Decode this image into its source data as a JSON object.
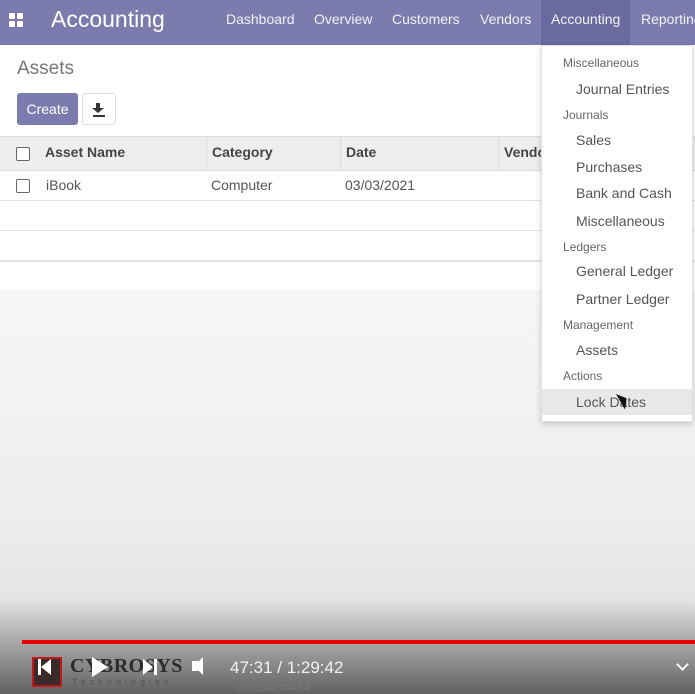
{
  "navbar": {
    "brand": "Accounting",
    "menu": [
      "Dashboard",
      "Overview",
      "Customers",
      "Vendors",
      "Accounting",
      "Reporting"
    ],
    "active": "Accounting",
    "bg_color": "#7c7bad"
  },
  "control_panel": {
    "title": "Assets",
    "create_label": "Create",
    "download_icon": "download-icon"
  },
  "list": {
    "columns": [
      "Asset Name",
      "Category",
      "Date",
      "Vendor"
    ],
    "rows": [
      {
        "asset_name": "iBook",
        "category": "Computer",
        "date": "03/03/2021",
        "vendor": ""
      }
    ]
  },
  "dropdown": {
    "sections": [
      {
        "header": "Miscellaneous",
        "items": [
          "Journal Entries"
        ]
      },
      {
        "header": "Journals",
        "items": [
          "Sales",
          "Purchases",
          "Bank and Cash",
          "Miscellaneous"
        ]
      },
      {
        "header": "Ledgers",
        "items": [
          "General Ledger",
          "Partner Ledger"
        ]
      },
      {
        "header": "Management",
        "items": [
          "Assets"
        ]
      },
      {
        "header": "Actions",
        "items": [
          "Lock Dates"
        ]
      }
    ],
    "hovered": "Lock Dates"
  },
  "video": {
    "time_display": "47:31 / 1:29:42",
    "logo_name": "CYBROSYS",
    "logo_sub": "Technologies",
    "url_fragment": "3&action=494",
    "progress_color": "#e60000"
  }
}
